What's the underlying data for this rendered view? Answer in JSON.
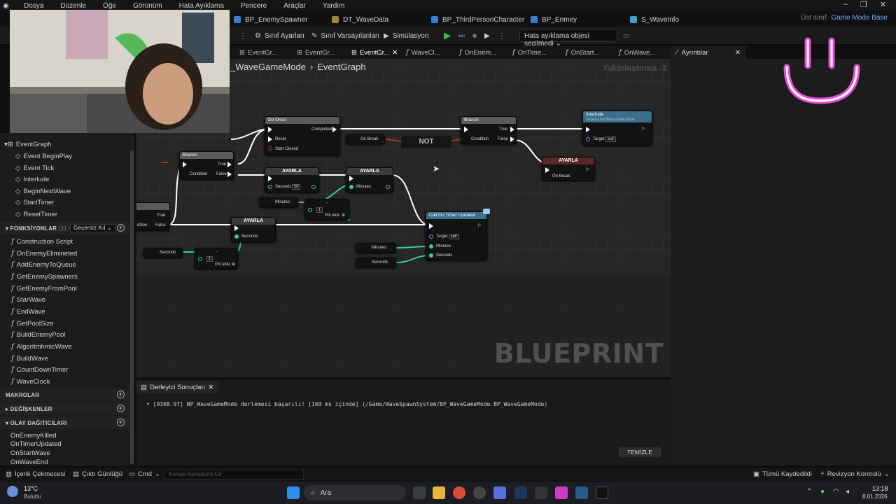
{
  "menu": [
    "Dosya",
    "Düzenle",
    "Öğe",
    "Görünüm",
    "Hata Ayıklama",
    "Pencere",
    "Araçlar",
    "Yardım"
  ],
  "asset_tabs": [
    "BP_EnemySpawner",
    "DT_WaveData",
    "BP_ThirdPersonCharacter",
    "BP_Enmey",
    "S_WaveInfo"
  ],
  "parent_class": {
    "label": "Üst sınıf:",
    "value": "Game Mode Base"
  },
  "toolbar": {
    "class_settings": "Sınıf Ayarları",
    "class_defaults": "Sınıf Varsayılanları",
    "simulation": "Simülasyon",
    "debug_object": "Hata ayıklama objesi seçilmedi"
  },
  "graph_tabs": [
    "EventGr...",
    "EventGr...",
    "EventGr...",
    "WaveCl...",
    "OnEnem...",
    "OnTime...",
    "OnStart...",
    "OnWave..."
  ],
  "details_tab": "Ayrıntılar",
  "breadcrumb": {
    "asset": "_WaveGameMode",
    "graph": "EventGraph"
  },
  "zoom": "Yakınlaştırma -3",
  "watermark": "BLUEPRINT",
  "left_panel": {
    "event_graph": "EventGraph",
    "events": [
      "Event BeginPlay",
      "Event Tick",
      "Interlude",
      "BeginNextWave",
      "StartTimer",
      "ResetTimer"
    ],
    "functions_header": "FONKSİYONLAR",
    "functions_count": "(31 GEÇE",
    "override_label": "Geçersiz Kıl",
    "functions": [
      "Construction Script",
      "OnEnemyElimineted",
      "AddEnemyToQueue",
      "GetEnemySpawners",
      "GetEnemyFromPool",
      "StarWave",
      "EndWave",
      "GetPoolSize",
      "BuildEnemyPool",
      "AlgoritmhmicWave",
      "BuildWave",
      "CountDownTimer",
      "WaveClock"
    ],
    "macros_header": "MAKROLAR",
    "variables_header": "DEĞİŞKENLER",
    "dispatchers_header": "OLAY DAĞITICILARI",
    "dispatchers": [
      "OnEnemyKilled",
      "OnTimerUpdated",
      "OnStartWave",
      "OnWaveEnd"
    ]
  },
  "nodes": {
    "do_once": {
      "title": "Do Once",
      "completed": "Completed",
      "reset": "Reset",
      "start_closed": "Start Closed"
    },
    "on_break_1": "On Break",
    "not": "NOT",
    "branch1": {
      "title": "Branch",
      "true": "True",
      "false": "False",
      "condition": "Condition"
    },
    "branch2": {
      "title": "Branch",
      "true": "True",
      "false": "False",
      "condition": "Condition"
    },
    "interlude": {
      "title": "Interlude",
      "subtitle": "Target is BP Wave Game Mode",
      "target": "Target",
      "self": "self"
    },
    "set_onbreak": {
      "title": "AYARLA",
      "pin": "On Break"
    },
    "set_seconds": {
      "title": "AYARLA",
      "pin": "Seconds",
      "value": "59"
    },
    "set_minutes": {
      "title": "AYARLA",
      "pin": "Minutes"
    },
    "minutes_get": "Minutes",
    "minus_node": {
      "value": "1",
      "add_pin": "Pin ekle"
    },
    "set_seconds2": {
      "title": "AYARLA",
      "pin": "Seconds"
    },
    "seconds_get": "Seconds",
    "minus_node2": {
      "value": "1",
      "add_pin": "Pin ekle"
    },
    "call_timer": {
      "title": "Call On Timer Updated",
      "target": "Target",
      "self": "self",
      "minutes": "Minutes",
      "seconds": "Seconds"
    },
    "minutes_get2": "Minutes",
    "seconds_get2": "Seconds",
    "left_branch": {
      "true": "True",
      "false": "False",
      "condition": "dition"
    }
  },
  "compiler": {
    "tab": "Derleyici Sonuçları",
    "log": "[9308.97] BP_WaveGameMode derlemesi başarılı! [169 ms içinde] (/Game/WaveSpawnSystem/BP_WaveGameMode.BP_WaveGameMode)",
    "clear": "TEMİZLE"
  },
  "statusbar": {
    "content_drawer": "İçerik Çekmecesi",
    "output_log": "Çıktı Günlüğü",
    "cmd": "Cmd",
    "console_placeholder": "Konsol Komutunu Gir",
    "save_all": "Tümü Kaydedildi",
    "revision": "Revizyon Kontrolü"
  },
  "taskbar": {
    "temp": "13°C",
    "weather": "Bulutlu",
    "search": "Ara",
    "time": "13:18",
    "date": "8.01.2026"
  },
  "colors": {
    "accent_pink": "#e84ad8",
    "exec_white": "#ffffff",
    "float_pin": "#3ec9a0",
    "bool_pin": "#8b1a1a"
  }
}
